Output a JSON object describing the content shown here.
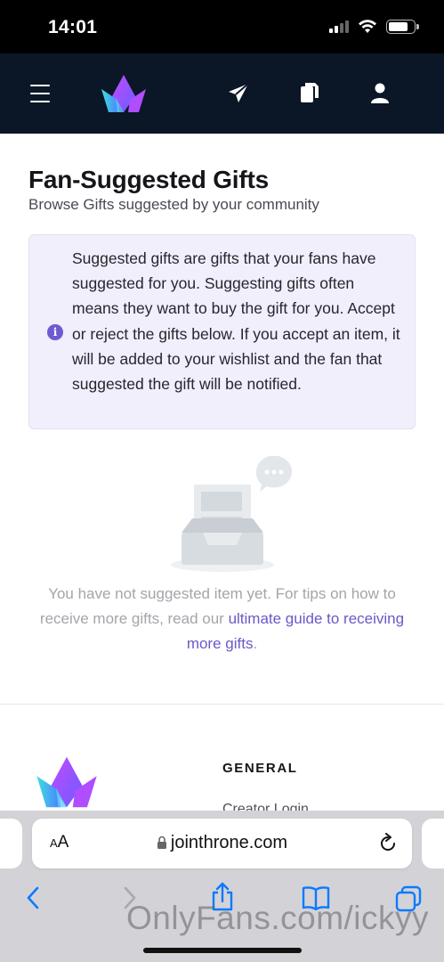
{
  "status_bar": {
    "time": "14:01"
  },
  "nav": {
    "icons": [
      "menu-icon",
      "throne-logo",
      "send-icon",
      "copy-icon",
      "user-icon"
    ]
  },
  "page": {
    "title": "Fan-Suggested Gifts",
    "subtitle": "Browse Gifts suggested by your community"
  },
  "info": {
    "icon": "info-icon",
    "icon_glyph": "i",
    "text": "Suggested gifts are gifts that your fans have suggested for you. Suggesting gifts often means they want to buy the gift for you. Accept or reject the gifts below. If you accept an item, it will be added to your wishlist and the fan that suggested the gift will be notified."
  },
  "empty_state": {
    "text": "You have not suggested item yet. For tips on how to receive more gifts, read our ",
    "link": "ultimate guide to receiving more gifts",
    "trailing": "."
  },
  "footer": {
    "heading": "GENERAL",
    "links": [
      "Creator Login"
    ]
  },
  "safari": {
    "aa_large": "A",
    "aa_small": "A",
    "url": "jointhrone.com",
    "icons": [
      "back-icon",
      "forward-icon",
      "share-icon",
      "bookmarks-icon",
      "tabs-icon",
      "reload-icon",
      "lock-icon"
    ]
  },
  "watermark": "OnlyFans.com/ickyy",
  "colors": {
    "navbar": "#0b1626",
    "accent": "#6a58c8",
    "info_bg": "#f0effb",
    "safari_bar": "#d3d3d7",
    "ios_blue": "#0a7aff"
  }
}
